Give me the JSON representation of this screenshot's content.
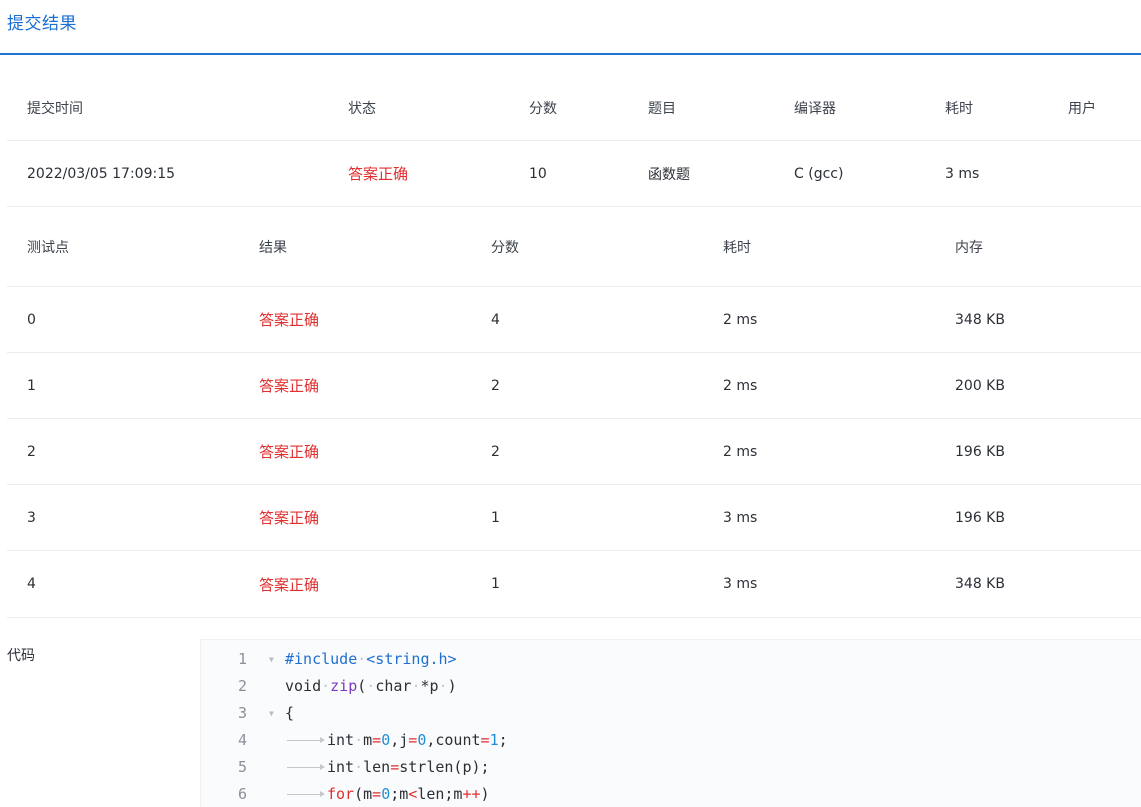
{
  "tab": {
    "title": "提交结果"
  },
  "summary": {
    "headers": [
      "提交时间",
      "状态",
      "分数",
      "题目",
      "编译器",
      "耗时",
      "用户"
    ],
    "row": {
      "time": "2022/03/05 17:09:15",
      "status": "答案正确",
      "score": "10",
      "problem": "函数题",
      "compiler": "C (gcc)",
      "duration": "3 ms",
      "user": ""
    }
  },
  "testcases": {
    "headers": [
      "测试点",
      "结果",
      "分数",
      "耗时",
      "内存"
    ],
    "rows": [
      {
        "id": "0",
        "result": "答案正确",
        "score": "4",
        "time": "2 ms",
        "memory": "348 KB"
      },
      {
        "id": "1",
        "result": "答案正确",
        "score": "2",
        "time": "2 ms",
        "memory": "200 KB"
      },
      {
        "id": "2",
        "result": "答案正确",
        "score": "2",
        "time": "2 ms",
        "memory": "196 KB"
      },
      {
        "id": "3",
        "result": "答案正确",
        "score": "1",
        "time": "3 ms",
        "memory": "196 KB"
      },
      {
        "id": "4",
        "result": "答案正确",
        "score": "1",
        "time": "3 ms",
        "memory": "348 KB"
      }
    ]
  },
  "code": {
    "label": "代码",
    "lines": [
      {
        "n": "1",
        "text": "#include <string.h>"
      },
      {
        "n": "2",
        "text": "void zip( char *p )"
      },
      {
        "n": "3",
        "text": "{"
      },
      {
        "n": "4",
        "text": "int m=0,j=0,count=1;"
      },
      {
        "n": "5",
        "text": "int len=strlen(p);"
      },
      {
        "n": "6",
        "text": "for(m=0;m<len;m++)"
      }
    ]
  },
  "colors": {
    "accent": "#1f74d6",
    "success_text": "#e02f2f"
  }
}
